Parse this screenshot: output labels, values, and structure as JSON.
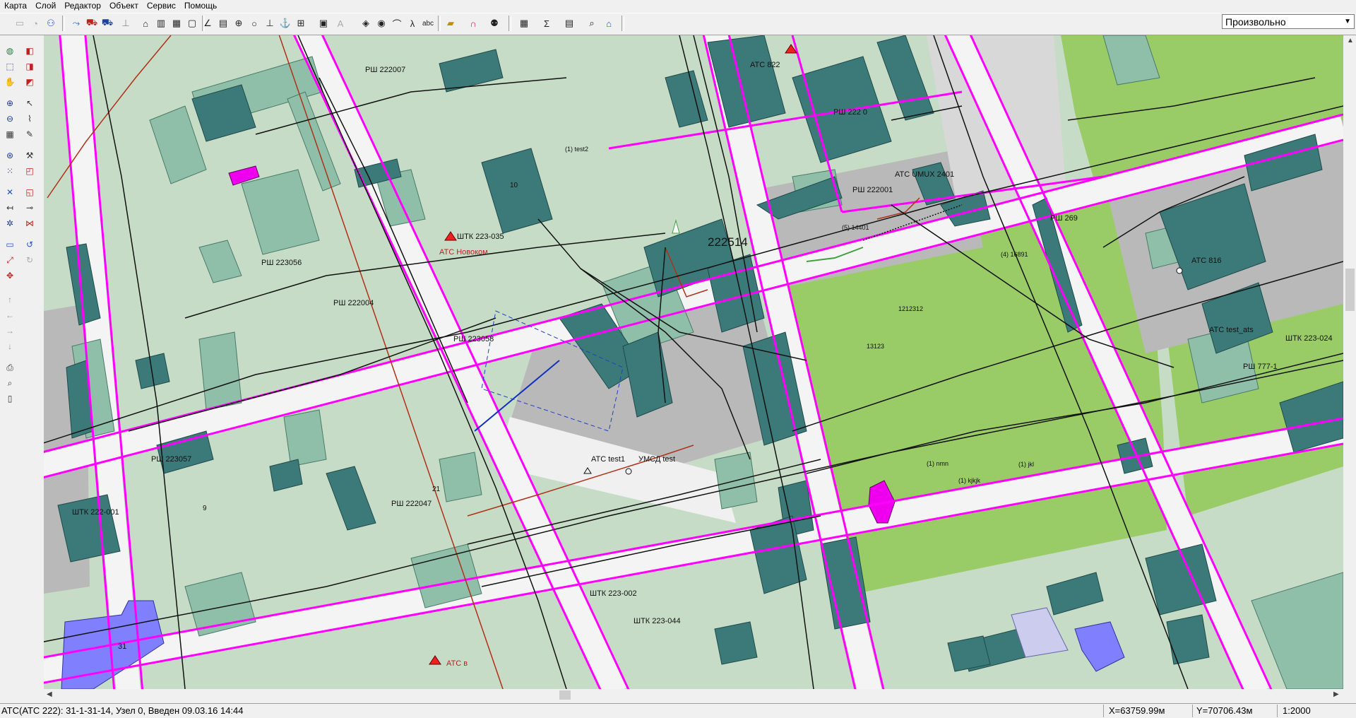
{
  "menu": [
    "Карта",
    "Слой",
    "Редактор",
    "Объект",
    "Сервис",
    "Помощь"
  ],
  "scale_combo": {
    "value": "Произвольно"
  },
  "map_labels": {
    "parcel_big": "222514",
    "atc_816": "АТС 816",
    "atc_822": "АТС 822",
    "atc_umux": "АТС UMUX 2401",
    "atc_test1": "АТС test1",
    "umcd_test": "УМСД test",
    "atc_test_ats": "АТС test_ats",
    "atc_novokom": "АТС Новоком",
    "atc_b": "АТС в",
    "shtk_223_035": "ШТК 223-035",
    "shtk_222_001": "ШТК 222-001",
    "shtk_223_002": "ШТК 223-002",
    "shtk_223_044": "ШТК 223-044",
    "shtk_223_024": "ШТК 223-024",
    "rsh_222007": "РШ 222007",
    "rsh_223056": "РШ 223056",
    "rsh_222004": "РШ 222004",
    "rsh_223058": "РШ 223058",
    "rsh_223057": "РШ 223057",
    "rsh_222047": "РШ 222047",
    "rsh_222001": "РШ 222001",
    "rsh_269": "РШ 269",
    "rsh_777_1": "РШ 777-1",
    "rsh_222_0": "РШ 222 0",
    "parcel_1212312": "1212312",
    "parcel_13123": "13123",
    "parcel_14401": "(5) 14401",
    "parcel_16891": "(4) 16891",
    "nmn": "(1) nmn",
    "kjkjk": "(1) kjkjk",
    "jkl": "(1) jkl",
    "test2": "(1) test2",
    "num_10": "10",
    "num_31": "31",
    "num_21": "21",
    "num_9": "9"
  },
  "status": {
    "info": "АТС(АТС 222): 31-1-31-14, Узел 0, Введен 09.03.16 14:44",
    "x": "X=63759.99м",
    "y": "Y=70706.43м",
    "scale": "1:2000"
  },
  "colors": {
    "background_green": "#c6dcc6",
    "building_teal": "#3c7a7a",
    "light_teal": "#8fbfa8",
    "road_magenta": "#ff00ff",
    "park_green": "#99cc66",
    "grey_zone": "#b9b9b9",
    "cable_red": "#b03018",
    "violet": "#8080ff"
  }
}
